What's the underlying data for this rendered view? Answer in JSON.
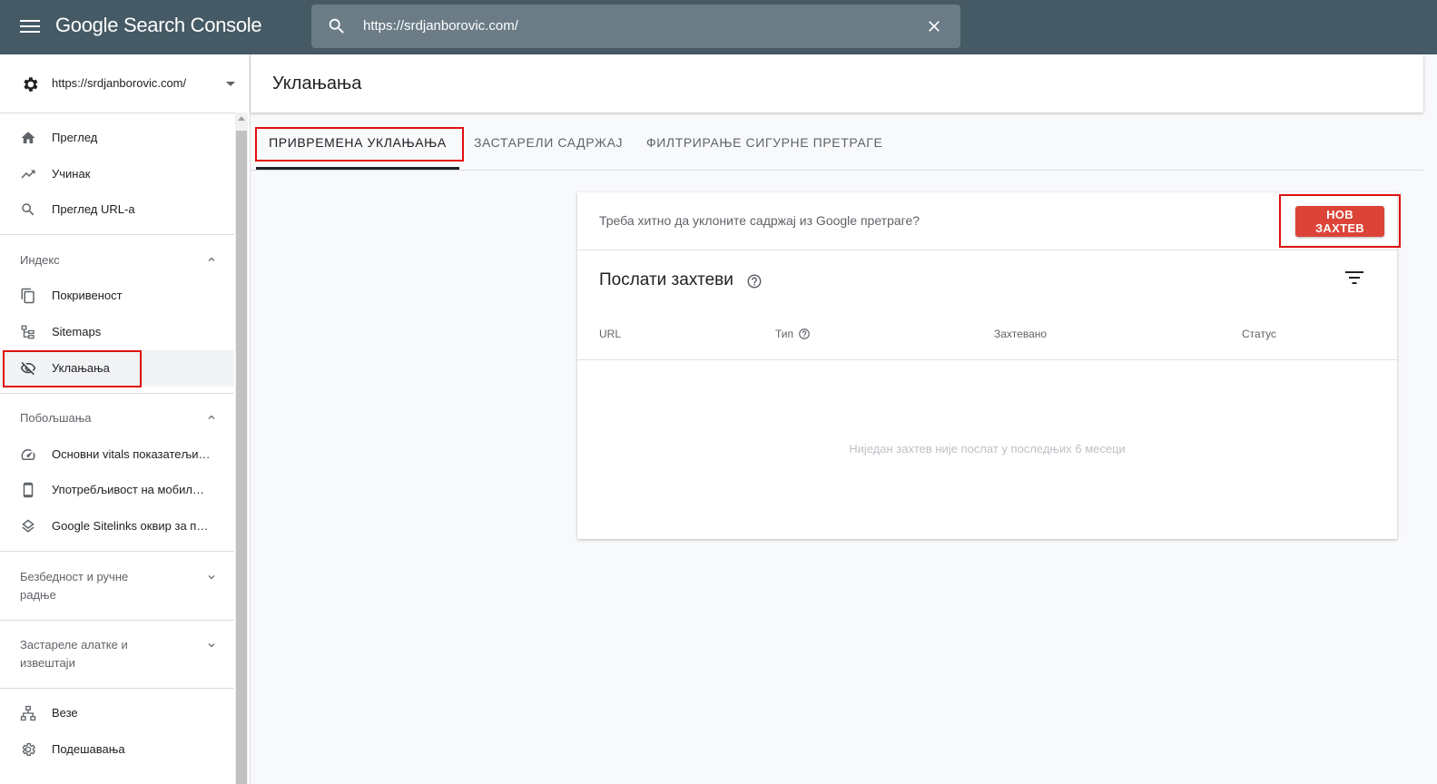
{
  "app": {
    "title": "Google Search Console"
  },
  "search": {
    "value": "https://srdjanborovic.com/"
  },
  "property": {
    "url": "https://srdjanborovic.com/"
  },
  "sidebar": {
    "top_items": [
      {
        "label": "Преглед",
        "icon": "home-icon"
      },
      {
        "label": "Учинак",
        "icon": "trending-up-icon"
      },
      {
        "label": "Преглед URL-a",
        "icon": "search-icon"
      }
    ],
    "index": {
      "label": "Индекс",
      "items": [
        {
          "label": "Покривеност",
          "icon": "copy-icon"
        },
        {
          "label": "Sitemaps",
          "icon": "sitemap-icon"
        },
        {
          "label": "Уклањања",
          "icon": "eye-off-icon",
          "active": true
        }
      ]
    },
    "enhancements": {
      "label": "Побољшања",
      "items": [
        {
          "label": "Основни vitals показатељи…",
          "icon": "speed-icon"
        },
        {
          "label": "Употребљивост на мобилн…",
          "icon": "mobile-icon"
        },
        {
          "label": "Google Sitelinks оквир за п…",
          "icon": "layers-icon"
        }
      ]
    },
    "security": {
      "label": "Безбедност и ручне радње"
    },
    "legacy": {
      "label": "Застареле алатке и извештаји"
    },
    "bottom_items": [
      {
        "label": "Везе",
        "icon": "links-icon"
      },
      {
        "label": "Подешавања",
        "icon": "settings-icon"
      }
    ]
  },
  "main": {
    "title": "Уклањања",
    "tabs": [
      {
        "label": "ПРИВРЕМЕНА УКЛАЊАЊА",
        "active": true
      },
      {
        "label": "ЗАСТАРЕЛИ САДРЖАЈ"
      },
      {
        "label": "ФИЛТРИРАЊЕ СИГУРНЕ ПРЕТРАГЕ"
      }
    ],
    "card": {
      "prompt": "Треба хитно да уклоните садржај из Google претраге?",
      "new_request": "НОВ ЗАХТЕВ",
      "subtitle": "Послати захтеви",
      "columns": [
        "URL",
        "Тип",
        "Захтевано",
        "Статус"
      ],
      "empty_message": "Ниједан захтев није послат у последњих 6 месеци"
    }
  },
  "colors": {
    "topbar": "#455a64",
    "accent_button": "#db4437",
    "highlight": "#e01010"
  }
}
